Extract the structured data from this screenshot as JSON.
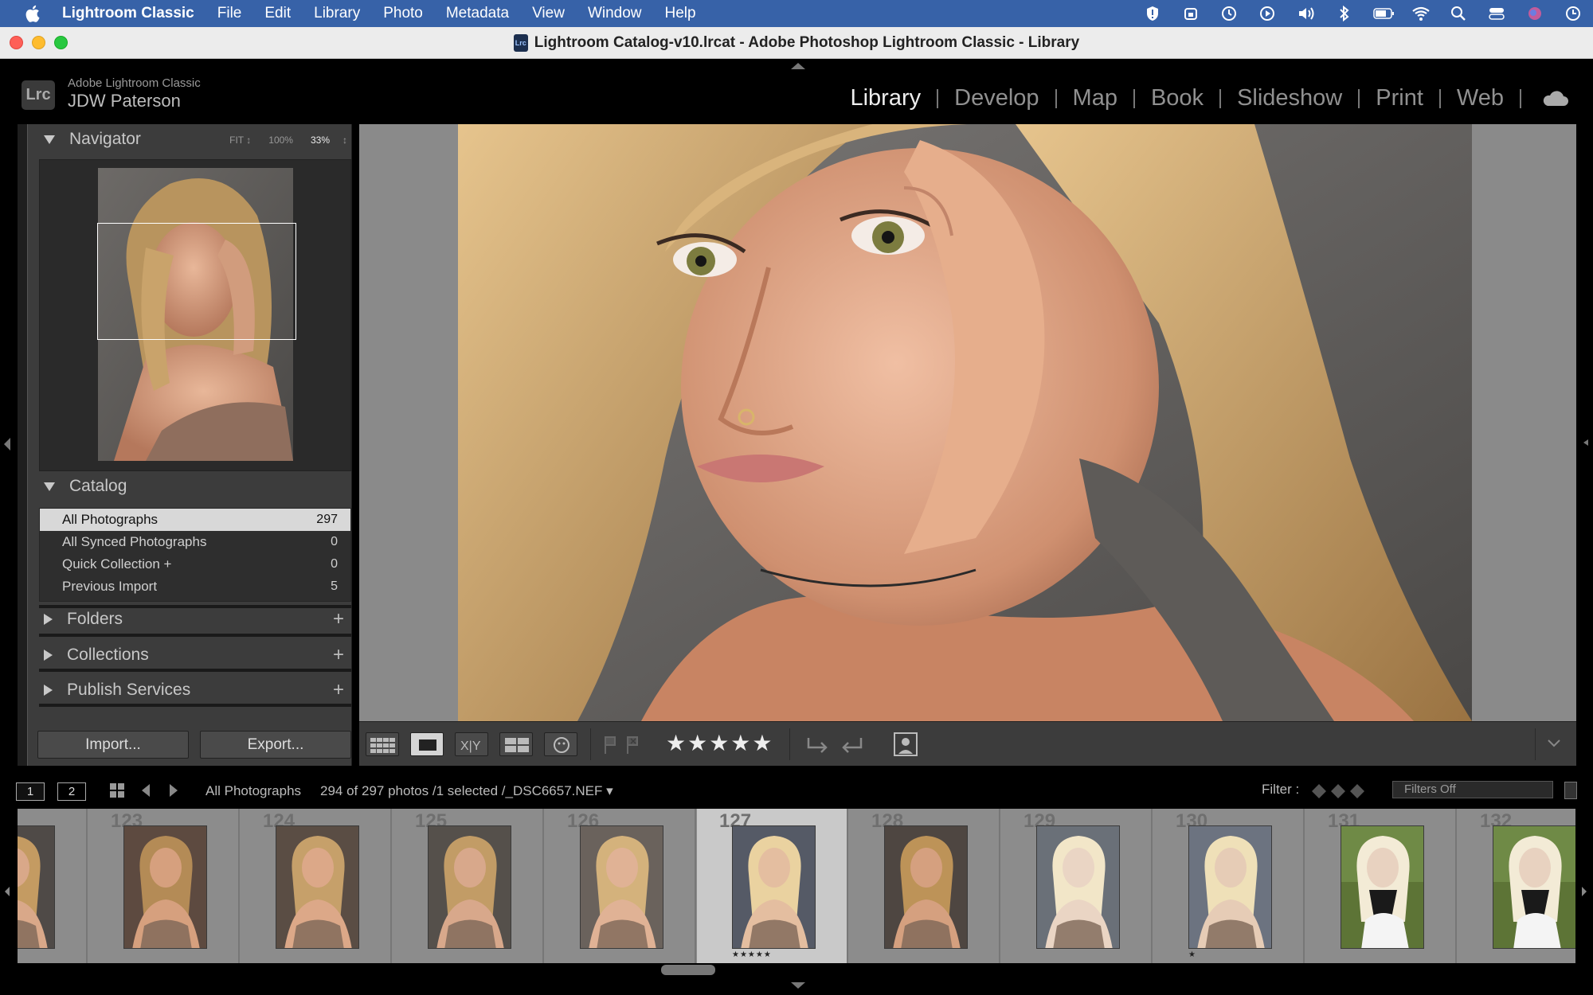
{
  "menubar": {
    "app": "Lightroom Classic",
    "items": [
      "File",
      "Edit",
      "Library",
      "Photo",
      "Metadata",
      "View",
      "Window",
      "Help"
    ],
    "status_icons": [
      "shield-icon",
      "vpn-icon",
      "time-machine-icon",
      "play-icon",
      "volume-icon",
      "bluetooth-icon",
      "battery-icon",
      "wifi-icon",
      "search-icon",
      "control-center-icon",
      "siri-icon",
      "clock-icon"
    ]
  },
  "window": {
    "title": "Lightroom Catalog-v10.lrcat - Adobe Photoshop Lightroom Classic - Library",
    "doc_icon": "Lrc"
  },
  "identity": {
    "logo": "Lrc",
    "product": "Adobe Lightroom Classic",
    "user": "JDW Paterson"
  },
  "modules": [
    "Library",
    "Develop",
    "Map",
    "Book",
    "Slideshow",
    "Print",
    "Web"
  ],
  "active_module": "Library",
  "navigator": {
    "title": "Navigator",
    "zoom_fit": "FIT ↕",
    "zoom_100": "100%",
    "zoom_33": "33%",
    "zoom_more": "↕"
  },
  "catalog": {
    "title": "Catalog",
    "rows": [
      {
        "label": "All Photographs",
        "count": "297"
      },
      {
        "label": "All Synced Photographs",
        "count": "0"
      },
      {
        "label": "Quick Collection  +",
        "count": "0"
      },
      {
        "label": "Previous Import",
        "count": "5"
      }
    ]
  },
  "panels": {
    "folders": "Folders",
    "collections": "Collections",
    "publish": "Publish Services",
    "plus": "+"
  },
  "buttons": {
    "import": "Import...",
    "export": "Export..."
  },
  "toolbar": {
    "stars": "★★★★★"
  },
  "filmstrip_header": {
    "monitor1": "1",
    "monitor2": "2",
    "source": "All Photographs",
    "info": "294 of 297 photos /1 selected /_DSC6657.NEF ▾",
    "filter_label": "Filter :",
    "filter_value": "Filters Off"
  },
  "filmstrip": [
    {
      "num": "",
      "stars": ""
    },
    {
      "num": "123",
      "stars": ""
    },
    {
      "num": "124",
      "stars": ""
    },
    {
      "num": "125",
      "stars": ""
    },
    {
      "num": "126",
      "stars": ""
    },
    {
      "num": "127",
      "stars": "★★★★★"
    },
    {
      "num": "128",
      "stars": ""
    },
    {
      "num": "129",
      "stars": ""
    },
    {
      "num": "130",
      "stars": "★"
    },
    {
      "num": "131",
      "stars": ""
    },
    {
      "num": "132",
      "stars": ""
    }
  ],
  "selected_index": 5
}
